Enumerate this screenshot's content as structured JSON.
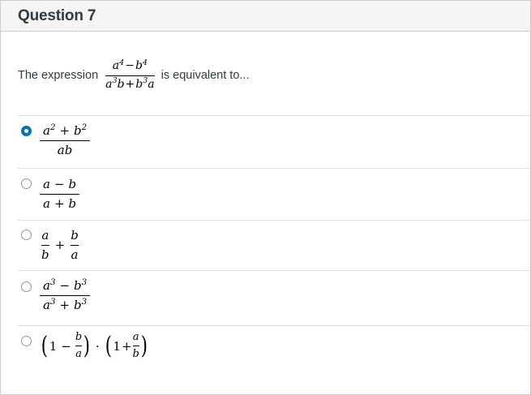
{
  "question": {
    "title": "Question 7",
    "prompt_before": "The expression",
    "prompt_after": "is equivalent to...",
    "expression": {
      "numerator": {
        "a": "a",
        "a_exp": "4",
        "minus": "−",
        "b": "b",
        "b_exp": "4"
      },
      "denominator": {
        "a": "a",
        "a_exp": "3",
        "b1": "b",
        "plus": "+",
        "b": "b",
        "b_exp": "3",
        "a2": "a"
      }
    }
  },
  "answers": [
    {
      "selected": true,
      "numerator": {
        "a": "a",
        "a_exp": "2",
        "plus": "+",
        "b": "b",
        "b_exp": "2"
      },
      "denominator": "ab"
    },
    {
      "selected": false,
      "numerator": {
        "a": "a",
        "minus": "−",
        "b": "b"
      },
      "denominator": {
        "a": "a",
        "plus": "+",
        "b": "b"
      }
    },
    {
      "selected": false,
      "left": {
        "num": "a",
        "den": "b"
      },
      "plus": "+",
      "right": {
        "num": "b",
        "den": "a"
      }
    },
    {
      "selected": false,
      "numerator": {
        "a": "a",
        "a_exp": "3",
        "minus": "−",
        "b": "b",
        "b_exp": "3"
      },
      "denominator": {
        "a": "a",
        "a_exp": "3",
        "plus": "+",
        "b": "b",
        "b_exp": "3"
      }
    },
    {
      "selected": false,
      "left": {
        "open": "(",
        "one": "1",
        "minus": "−",
        "num": "b",
        "den": "a",
        "close": ")"
      },
      "dot": "·",
      "right": {
        "open": "(",
        "one": "1",
        "plus": "+",
        "num": "a",
        "den": "b",
        "close": ")"
      }
    }
  ],
  "colors": {
    "selected_radio": "#0374b5",
    "header_bg": "#f5f5f5",
    "border": "#c7cdd1",
    "divider": "#dfe2e4",
    "text": "#2d3b45"
  }
}
